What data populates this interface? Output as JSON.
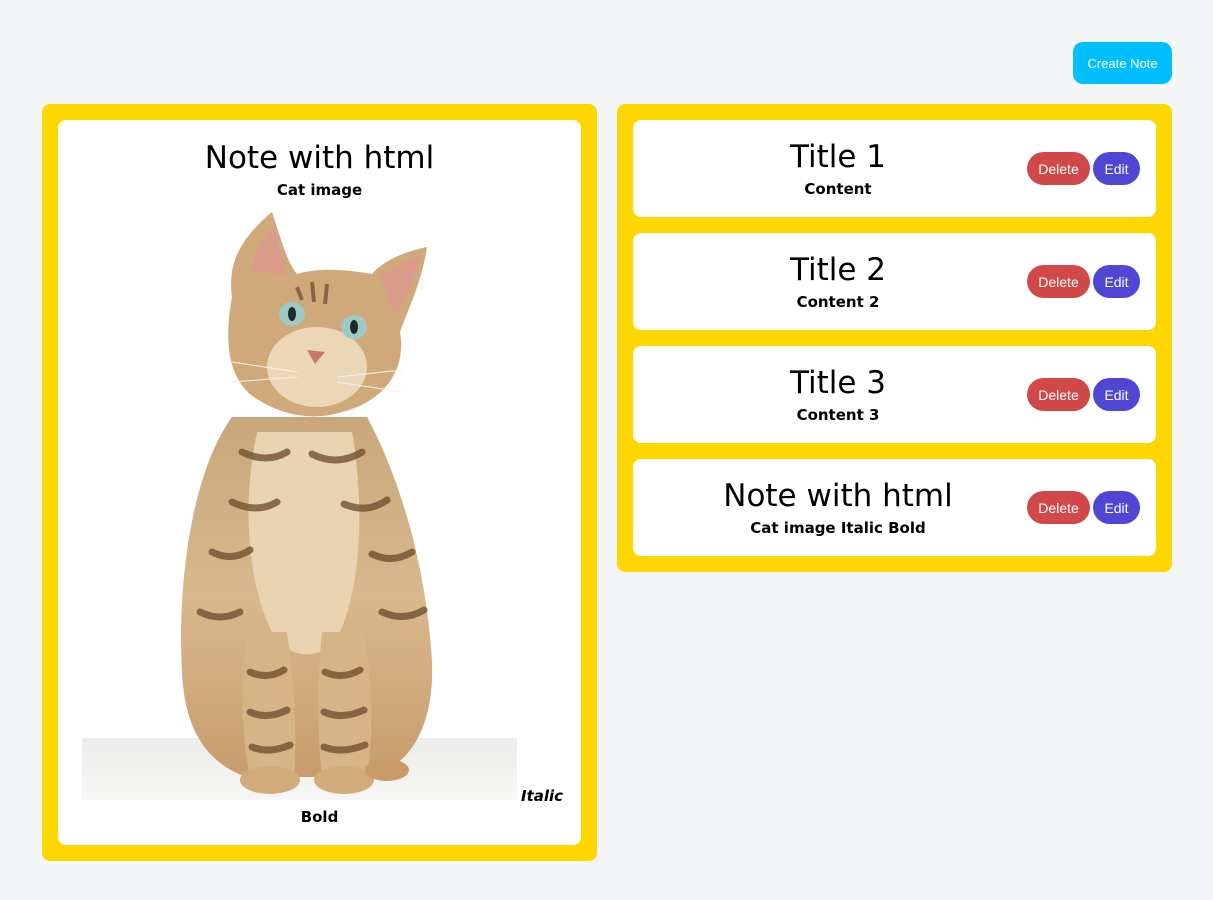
{
  "toolbar": {
    "create_label": "Create Note"
  },
  "colors": {
    "panel_background": "#ffd700",
    "create_button": "#00bfff",
    "delete_button": "#d04848",
    "edit_button": "#5046d4",
    "page_background": "#f4f5f7",
    "card_background": "#ffffff"
  },
  "detail": {
    "title": "Note with html",
    "subtitle": "Cat image",
    "image_icon": "cat-photo",
    "italic_text": "Italic",
    "bold_text": "Bold"
  },
  "notes": [
    {
      "title": "Title 1",
      "content": "Content",
      "delete_label": "Delete",
      "edit_label": "Edit"
    },
    {
      "title": "Title 2",
      "content": "Content 2",
      "delete_label": "Delete",
      "edit_label": "Edit"
    },
    {
      "title": "Title 3",
      "content": "Content 3",
      "delete_label": "Delete",
      "edit_label": "Edit"
    },
    {
      "title": "Note with html",
      "content": "Cat image Italic Bold",
      "delete_label": "Delete",
      "edit_label": "Edit"
    }
  ]
}
